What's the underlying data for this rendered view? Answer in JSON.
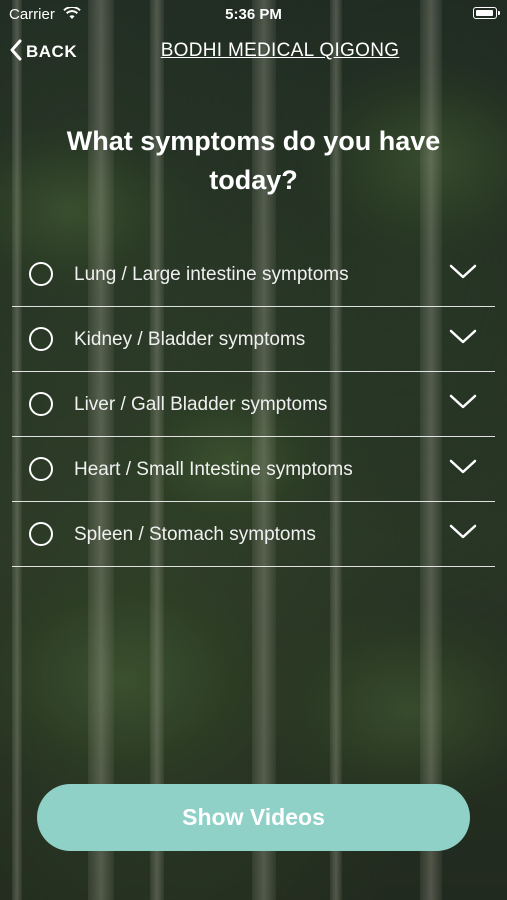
{
  "status_bar": {
    "carrier": "Carrier",
    "time": "5:36 PM",
    "icons": [
      "wifi-icon",
      "battery-icon"
    ]
  },
  "nav": {
    "back_label": "BACK",
    "title": "BODHI MEDICAL QIGONG"
  },
  "question": "What symptoms do you have today?",
  "symptoms": [
    {
      "label": "Lung / Large intestine symptoms",
      "selected": false
    },
    {
      "label": "Kidney / Bladder symptoms",
      "selected": false
    },
    {
      "label": "Liver / Gall Bladder symptoms",
      "selected": false
    },
    {
      "label": "Heart / Small Intestine symptoms",
      "selected": false
    },
    {
      "label": "Spleen / Stomach symptoms",
      "selected": false
    }
  ],
  "show_button_label": "Show Videos",
  "colors": {
    "button": "#8fd0c7",
    "text": "#ffffff"
  }
}
